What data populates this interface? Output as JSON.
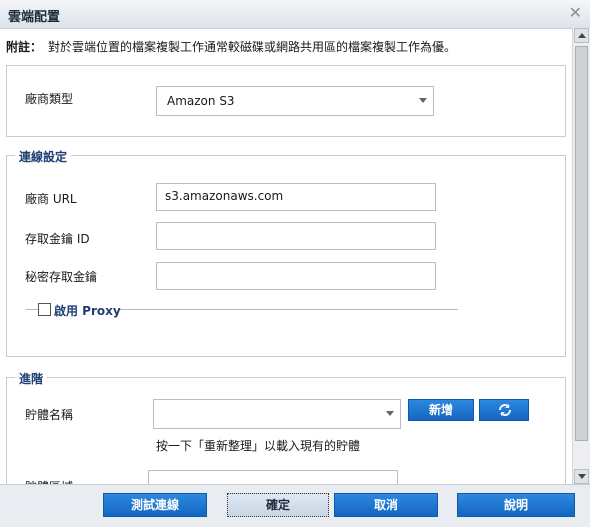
{
  "dialog": {
    "title": "雲端配置"
  },
  "note": {
    "label": "附註：",
    "text": "對於雲端位置的檔案複製工作通常較磁碟或網路共用區的檔案複製工作為優。"
  },
  "vendor_type": {
    "label": "廠商類型",
    "value": "Amazon S3"
  },
  "connection": {
    "legend": "連線設定",
    "vendor_url": {
      "label": "廠商 URL",
      "value": "s3.amazonaws.com"
    },
    "access_key_id": {
      "label": "存取金鑰 ID",
      "value": ""
    },
    "secret_key": {
      "label": "秘密存取金鑰",
      "value": ""
    },
    "proxy": {
      "label": "啟用 Proxy",
      "checked": false
    }
  },
  "advanced": {
    "legend": "進階",
    "bucket_name": {
      "label": "貯體名稱",
      "value": ""
    },
    "add_button": "新增",
    "refresh_hint": "按一下「重新整理」以載入現有的貯體",
    "bucket_region": {
      "label": "貯體區域",
      "value": ""
    }
  },
  "footer": {
    "test_button": "測試連線",
    "ok_button": "確定",
    "cancel_button": "取消",
    "help_button": "說明"
  },
  "colors": {
    "accent": "#1566c0",
    "legend_text": "#1f3f73"
  },
  "icons": [
    "close-icon",
    "refresh-icon",
    "chevron-down-icon"
  ]
}
